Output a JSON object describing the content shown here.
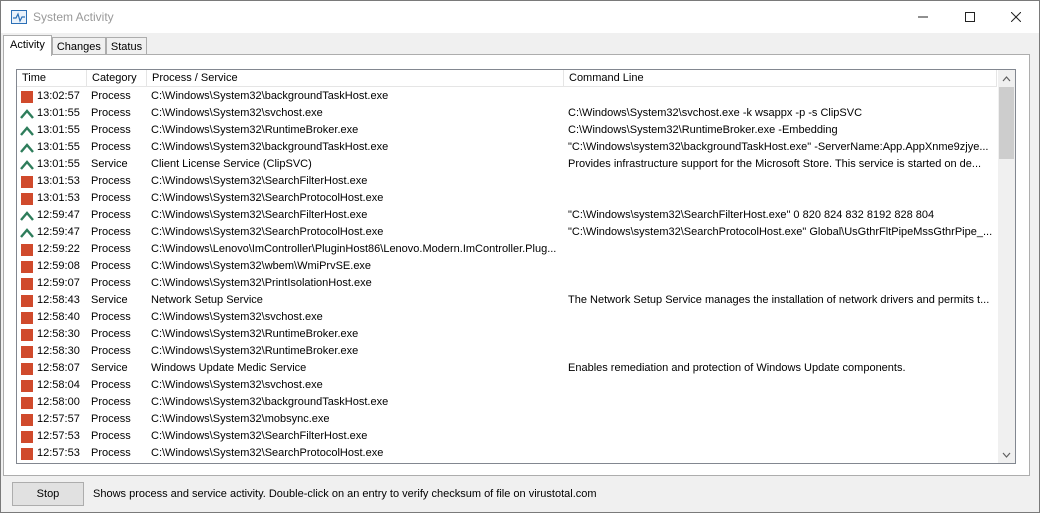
{
  "window": {
    "title": "System Activity",
    "icon": "activity-monitor-icon",
    "controls": [
      "minimize-icon",
      "maximize-icon",
      "close-icon"
    ]
  },
  "tabs": [
    {
      "label": "Activity",
      "active": true
    },
    {
      "label": "Changes",
      "active": false
    },
    {
      "label": "Status",
      "active": false
    }
  ],
  "table": {
    "columns": [
      "Time",
      "Category",
      "Process / Service",
      "Command Line"
    ],
    "rows": [
      {
        "icon": "stop",
        "time": "13:02:57",
        "category": "Process",
        "process": "C:\\Windows\\System32\\backgroundTaskHost.exe",
        "command": ""
      },
      {
        "icon": "start",
        "time": "13:01:55",
        "category": "Process",
        "process": "C:\\Windows\\System32\\svchost.exe",
        "command": "C:\\Windows\\System32\\svchost.exe -k wsappx -p -s ClipSVC"
      },
      {
        "icon": "start",
        "time": "13:01:55",
        "category": "Process",
        "process": "C:\\Windows\\System32\\RuntimeBroker.exe",
        "command": "C:\\Windows\\System32\\RuntimeBroker.exe -Embedding"
      },
      {
        "icon": "start",
        "time": "13:01:55",
        "category": "Process",
        "process": "C:\\Windows\\System32\\backgroundTaskHost.exe",
        "command": "\"C:\\Windows\\system32\\backgroundTaskHost.exe\" -ServerName:App.AppXnme9zjye..."
      },
      {
        "icon": "start",
        "time": "13:01:55",
        "category": "Service",
        "process": "Client License Service (ClipSVC)",
        "command": "Provides infrastructure support for the Microsoft Store. This service is started on de..."
      },
      {
        "icon": "stop",
        "time": "13:01:53",
        "category": "Process",
        "process": "C:\\Windows\\System32\\SearchFilterHost.exe",
        "command": ""
      },
      {
        "icon": "stop",
        "time": "13:01:53",
        "category": "Process",
        "process": "C:\\Windows\\System32\\SearchProtocolHost.exe",
        "command": ""
      },
      {
        "icon": "start",
        "time": "12:59:47",
        "category": "Process",
        "process": "C:\\Windows\\System32\\SearchFilterHost.exe",
        "command": "\"C:\\Windows\\system32\\SearchFilterHost.exe\" 0 820 824 832 8192 828 804"
      },
      {
        "icon": "start",
        "time": "12:59:47",
        "category": "Process",
        "process": "C:\\Windows\\System32\\SearchProtocolHost.exe",
        "command": "\"C:\\Windows\\system32\\SearchProtocolHost.exe\" Global\\UsGthrFltPipeMssGthrPipe_..."
      },
      {
        "icon": "stop",
        "time": "12:59:22",
        "category": "Process",
        "process": "C:\\Windows\\Lenovo\\ImController\\PluginHost86\\Lenovo.Modern.ImController.Plug...",
        "command": ""
      },
      {
        "icon": "stop",
        "time": "12:59:08",
        "category": "Process",
        "process": "C:\\Windows\\System32\\wbem\\WmiPrvSE.exe",
        "command": ""
      },
      {
        "icon": "stop",
        "time": "12:59:07",
        "category": "Process",
        "process": "C:\\Windows\\System32\\PrintIsolationHost.exe",
        "command": ""
      },
      {
        "icon": "stop",
        "time": "12:58:43",
        "category": "Service",
        "process": "Network Setup Service",
        "command": "The Network Setup Service manages the installation of network drivers and permits t..."
      },
      {
        "icon": "stop",
        "time": "12:58:40",
        "category": "Process",
        "process": "C:\\Windows\\System32\\svchost.exe",
        "command": ""
      },
      {
        "icon": "stop",
        "time": "12:58:30",
        "category": "Process",
        "process": "C:\\Windows\\System32\\RuntimeBroker.exe",
        "command": ""
      },
      {
        "icon": "stop",
        "time": "12:58:30",
        "category": "Process",
        "process": "C:\\Windows\\System32\\RuntimeBroker.exe",
        "command": ""
      },
      {
        "icon": "stop",
        "time": "12:58:07",
        "category": "Service",
        "process": "Windows Update Medic Service",
        "command": "Enables remediation and protection of Windows Update components."
      },
      {
        "icon": "stop",
        "time": "12:58:04",
        "category": "Process",
        "process": "C:\\Windows\\System32\\svchost.exe",
        "command": ""
      },
      {
        "icon": "stop",
        "time": "12:58:00",
        "category": "Process",
        "process": "C:\\Windows\\System32\\backgroundTaskHost.exe",
        "command": ""
      },
      {
        "icon": "stop",
        "time": "12:57:57",
        "category": "Process",
        "process": "C:\\Windows\\System32\\mobsync.exe",
        "command": ""
      },
      {
        "icon": "stop",
        "time": "12:57:53",
        "category": "Process",
        "process": "C:\\Windows\\System32\\SearchFilterHost.exe",
        "command": ""
      },
      {
        "icon": "stop",
        "time": "12:57:53",
        "category": "Process",
        "process": "C:\\Windows\\System32\\SearchProtocolHost.exe",
        "command": ""
      }
    ]
  },
  "footer": {
    "stop_label": "Stop",
    "status": "Shows process and service activity. Double-click on an entry to verify checksum of file on virustotal.com"
  },
  "colors": {
    "stop_icon": "#d04a2c",
    "start_icon": "#2e7d5b"
  }
}
